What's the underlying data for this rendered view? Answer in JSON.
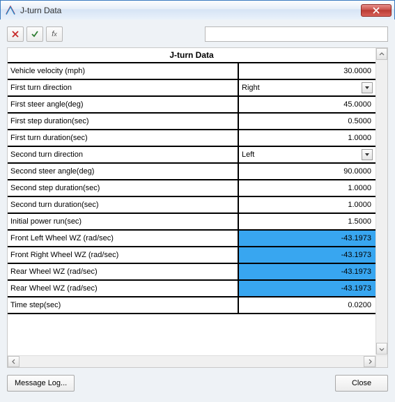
{
  "window": {
    "title": "J-turn Data"
  },
  "toolbar": {
    "input_value": ""
  },
  "grid": {
    "header": "J-turn Data",
    "rows": [
      {
        "label": "Vehicle velocity (mph)",
        "value": "30.0000",
        "type": "number"
      },
      {
        "label": "First turn direction",
        "value": "Right",
        "type": "select"
      },
      {
        "label": "First steer angle(deg)",
        "value": "45.0000",
        "type": "number"
      },
      {
        "label": "First step duration(sec)",
        "value": "0.5000",
        "type": "number"
      },
      {
        "label": "First turn duration(sec)",
        "value": "1.0000",
        "type": "number"
      },
      {
        "label": "Second turn direction",
        "value": "Left",
        "type": "select"
      },
      {
        "label": "Second steer angle(deg)",
        "value": "90.0000",
        "type": "number"
      },
      {
        "label": "Second step duration(sec)",
        "value": "1.0000",
        "type": "number"
      },
      {
        "label": "Second turn duration(sec)",
        "value": "1.0000",
        "type": "number"
      },
      {
        "label": "Initial power run(sec)",
        "value": "1.5000",
        "type": "number"
      },
      {
        "label": "Front Left Wheel WZ (rad/sec)",
        "value": "-43.1973",
        "type": "number",
        "highlight": true
      },
      {
        "label": "Front Right Wheel WZ (rad/sec)",
        "value": "-43.1973",
        "type": "number",
        "highlight": true
      },
      {
        "label": "Rear Wheel WZ (rad/sec)",
        "value": "-43.1973",
        "type": "number",
        "highlight": true
      },
      {
        "label": "Rear Wheel WZ (rad/sec)",
        "value": "-43.1973",
        "type": "number",
        "highlight": true
      },
      {
        "label": "Time step(sec)",
        "value": "0.0200",
        "type": "number"
      }
    ]
  },
  "buttons": {
    "message_log": "Message Log...",
    "close": "Close"
  }
}
